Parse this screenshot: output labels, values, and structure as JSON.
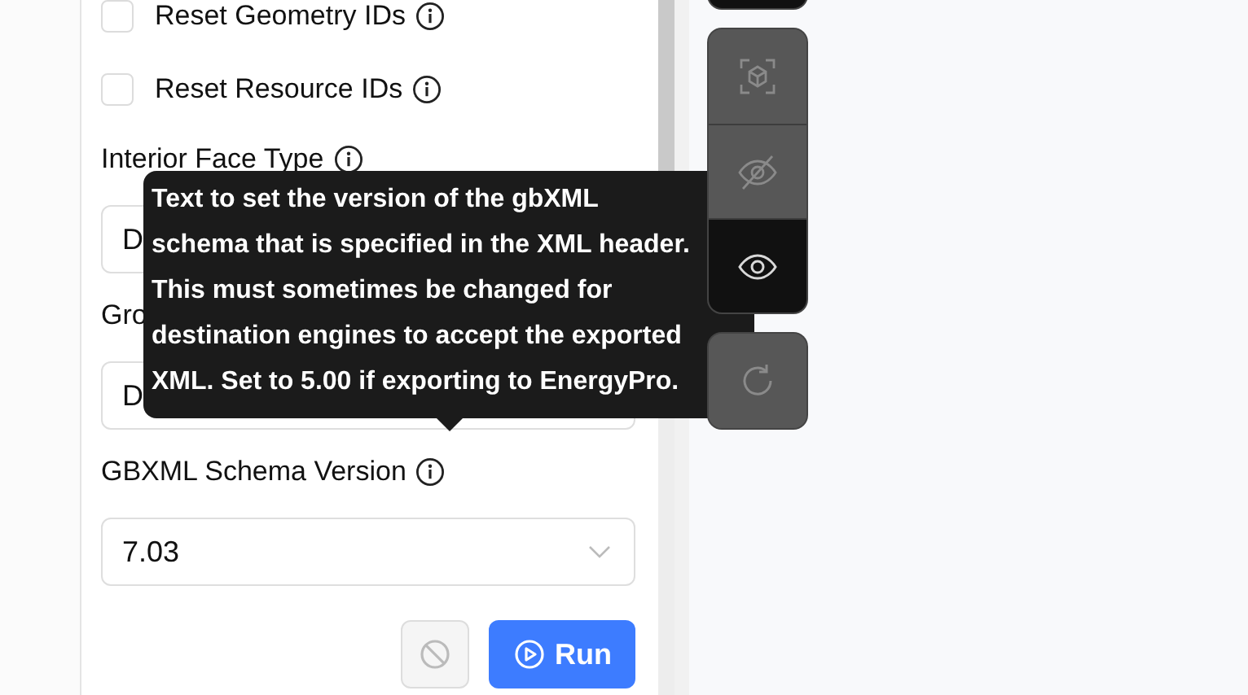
{
  "options": [
    {
      "kind": "checkbox",
      "label": "Reset Geometry IDs",
      "checked": false
    },
    {
      "kind": "checkbox",
      "label": "Reset Resource IDs",
      "checked": false
    }
  ],
  "fields": [
    {
      "label": "Interior Face Type",
      "value": "D"
    },
    {
      "label": "Gro",
      "value": "D"
    },
    {
      "label": "GBXML Schema Version",
      "value": "7.03"
    }
  ],
  "actions": [
    {
      "kind": "stop",
      "disabled": true
    },
    {
      "kind": "run",
      "label": "Run",
      "disabled": false
    }
  ],
  "toolbar": {
    "groups": [
      [
        {
          "kind": "plain",
          "selected": true
        }
      ],
      [
        {
          "kind": "focus",
          "selected": false
        },
        {
          "kind": "hide",
          "selected": false
        },
        {
          "kind": "show",
          "selected": true
        }
      ],
      [
        {
          "kind": "refresh",
          "selected": false
        }
      ]
    ]
  },
  "tooltip": {
    "text": "Text to set the version of the gbXML\nschema that is specified in the XML header.\nThis must sometimes be changed for\ndestination engines to accept the exported\nXML. Set to 5.00 if exporting to EnergyPro."
  }
}
